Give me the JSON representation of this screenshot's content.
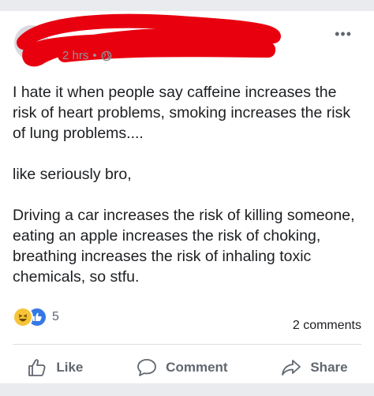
{
  "post": {
    "timestamp": "2 hrs",
    "separator": "•",
    "privacy_icon": "globe-icon",
    "more_label": "•••",
    "body": "I hate it when people say caffeine increases the risk of heart problems, smoking increases the risk of lung problems....\n\nlike seriously bro,\n\nDriving a car increases the risk of killing someone, eating an apple increases the risk of choking, breathing increases the risk of inhaling toxic chemicals, so stfu."
  },
  "stats": {
    "reaction_icons": [
      "haha-icon",
      "like-reaction-icon"
    ],
    "reaction_count": "5",
    "comments": "2 comments"
  },
  "actions": {
    "like_label": "Like",
    "comment_label": "Comment",
    "share_label": "Share"
  },
  "colors": {
    "redaction": "#e8000f",
    "text": "#1c1e21",
    "muted": "#606770"
  }
}
